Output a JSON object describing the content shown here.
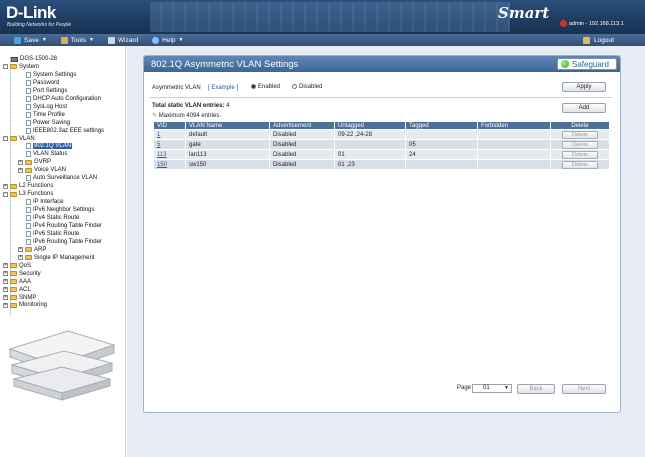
{
  "header": {
    "brand": "D-Link",
    "tagline": "Building Networks for People",
    "product_mark": "Smart",
    "user": "admin - 192.168.113.1"
  },
  "menu": {
    "save": "Save",
    "tools": "Tools",
    "wizard": "Wizard",
    "help": "Help",
    "logout": "Logout"
  },
  "tree": [
    {
      "label": "DGS-1500-28",
      "level": 0,
      "icon": "device-icon"
    },
    {
      "label": "System",
      "level": 0,
      "icon": "folder-icon",
      "toggle": "-"
    },
    {
      "label": "System Settings",
      "level": 1,
      "icon": "page-icon"
    },
    {
      "label": "Password",
      "level": 1,
      "icon": "page-icon"
    },
    {
      "label": "Port Settings",
      "level": 1,
      "icon": "page-icon"
    },
    {
      "label": "DHCP Auto Configuration",
      "level": 1,
      "icon": "page-icon"
    },
    {
      "label": "SysLog Host",
      "level": 1,
      "icon": "page-icon"
    },
    {
      "label": "Time Profile",
      "level": 1,
      "icon": "page-icon"
    },
    {
      "label": "Power Saving",
      "level": 1,
      "icon": "page-icon"
    },
    {
      "label": "IEEE802.3az EEE settings",
      "level": 1,
      "icon": "page-icon"
    },
    {
      "label": "VLAN",
      "level": 0,
      "icon": "folder-icon",
      "toggle": "-"
    },
    {
      "label": "802.1Q VLAN",
      "level": 1,
      "icon": "page-icon",
      "selected": true
    },
    {
      "label": "VLAN Status",
      "level": 1,
      "icon": "page-icon"
    },
    {
      "label": "GVRP",
      "level": 1,
      "icon": "folder-icon",
      "toggle": "+"
    },
    {
      "label": "Voice VLAN",
      "level": 1,
      "icon": "folder-icon",
      "toggle": "+"
    },
    {
      "label": "Auto Surveillance VLAN",
      "level": 1,
      "icon": "page-icon"
    },
    {
      "label": "L2 Functions",
      "level": 0,
      "icon": "folder-icon",
      "toggle": "+"
    },
    {
      "label": "L3 Functions",
      "level": 0,
      "icon": "folder-icon",
      "toggle": "-"
    },
    {
      "label": "IP Interface",
      "level": 1,
      "icon": "page-icon"
    },
    {
      "label": "IPv6 Neighbor Settings",
      "level": 1,
      "icon": "page-icon"
    },
    {
      "label": "IPv4 Static Route",
      "level": 1,
      "icon": "page-icon"
    },
    {
      "label": "IPv4 Routing Table Finder",
      "level": 1,
      "icon": "page-icon"
    },
    {
      "label": "IPv6 Static Route",
      "level": 1,
      "icon": "page-icon"
    },
    {
      "label": "IPv6 Routing Table Finder",
      "level": 1,
      "icon": "page-icon"
    },
    {
      "label": "ARP",
      "level": 1,
      "icon": "folder-icon",
      "toggle": "+"
    },
    {
      "label": "Single IP Management",
      "level": 1,
      "icon": "folder-icon",
      "toggle": "+"
    },
    {
      "label": "QoS",
      "level": 0,
      "icon": "folder-icon",
      "toggle": "+"
    },
    {
      "label": "Security",
      "level": 0,
      "icon": "folder-icon",
      "toggle": "+"
    },
    {
      "label": "AAA",
      "level": 0,
      "icon": "folder-icon",
      "toggle": "+"
    },
    {
      "label": "ACL",
      "level": 0,
      "icon": "folder-icon",
      "toggle": "+"
    },
    {
      "label": "SNMP",
      "level": 0,
      "icon": "folder-icon",
      "toggle": "+"
    },
    {
      "label": "Monitoring",
      "level": 0,
      "icon": "folder-icon",
      "toggle": "+"
    }
  ],
  "panel": {
    "title": "802.1Q Asymmetric VLAN Settings",
    "safeguard": "Safeguard",
    "asym_label": "Asymmetric VLAN",
    "example_link": "[ Example ]",
    "enabled": "Enabled",
    "disabled": "Disabled",
    "asym_selected": "Enabled",
    "apply": "Apply",
    "add": "Add",
    "total_label": "Total static VLAN entries:",
    "total_value": "4",
    "max_note": "Maximum 4094 entries."
  },
  "table": {
    "headers": [
      "VID",
      "VLAN Name",
      "Advertisement",
      "Untagged",
      "Tagged",
      "Forbidden",
      "Delete"
    ],
    "rows": [
      {
        "vid": "1",
        "name": "default",
        "adv": "Disabled",
        "untagged": "09-22 ,24-28",
        "tagged": "",
        "forbidden": "",
        "delete": "Delete"
      },
      {
        "vid": "5",
        "name": "gate",
        "adv": "Disabled",
        "untagged": "",
        "tagged": "05",
        "forbidden": "",
        "delete": "Delete"
      },
      {
        "vid": "113",
        "name": "lan113",
        "adv": "Disabled",
        "untagged": "01",
        "tagged": "24",
        "forbidden": "",
        "delete": "Delete"
      },
      {
        "vid": "150",
        "name": "sw150",
        "adv": "Disabled",
        "untagged": "01 ,23",
        "tagged": "",
        "forbidden": "",
        "delete": "Delete"
      }
    ]
  },
  "pager": {
    "label": "Page",
    "current": "01",
    "back": "Back",
    "next": "Next"
  }
}
